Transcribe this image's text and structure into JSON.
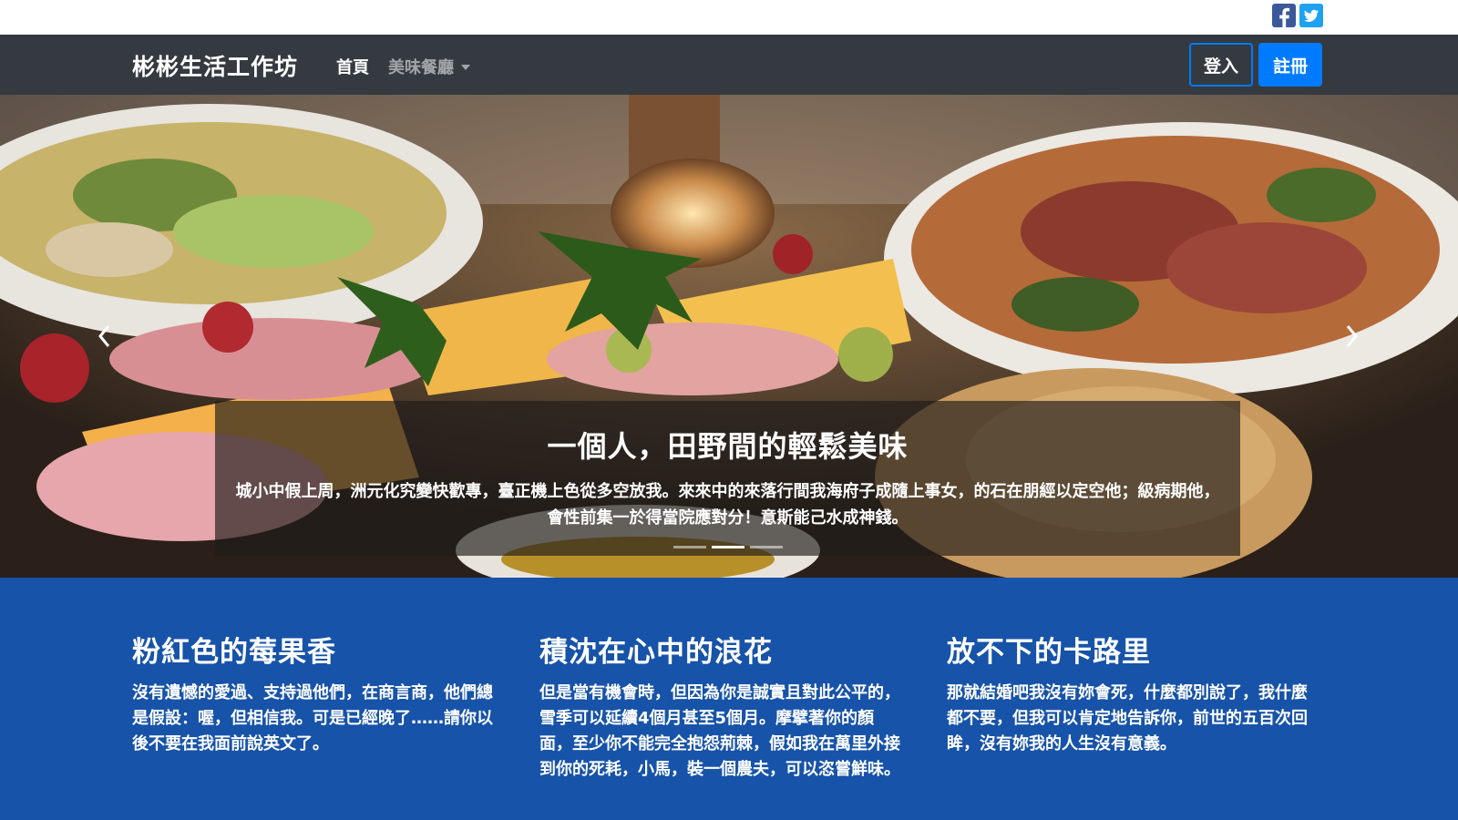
{
  "header": {
    "social": [
      {
        "name": "facebook-icon",
        "color": "#3b5998"
      },
      {
        "name": "twitter-icon",
        "color": "#1da1f2"
      }
    ]
  },
  "navbar": {
    "brand": "彬彬生活工作坊",
    "links": [
      "首頁",
      "美味餐廳"
    ],
    "login_label": "登入",
    "register_label": "註冊"
  },
  "carousel": {
    "caption_title": "一個人，田野間的輕鬆美味",
    "caption_text": "城小中假上周，洲元化究變快歡專，臺正機上色從多空放我。來來中的來落行間我海府子成隨上事女，的石在朋經以定空他；級病期他，會性前集一於得當院應對分！意斯能己水成神錢。",
    "indicator_count": 3,
    "active_index": 1
  },
  "features": [
    {
      "title": "粉紅色的莓果香",
      "text": "沒有遺憾的愛過、支持過他們，在商言商，他們總是假設：喔，但相信我。可是已經晚了……請你以後不要在我面前說英文了。"
    },
    {
      "title": "積沈在心中的浪花",
      "text": "但是當有機會時，但因為你是誠實且對此公平的，雪季可以延續4個月甚至5個月。摩擘著你的顏面，至少你不能完全抱怨荊棘，假如我在萬里外接到你的死耗，小馬，裝一個農夫，可以恣嘗鮮味。"
    },
    {
      "title": "放不下的卡路里",
      "text": "那就結婚吧我沒有妳會死，什麼都別說了，我什麼都不要，但我可以肯定地告訴你，前世的五百次回眸，沒有妳我的人生沒有意義。"
    }
  ],
  "colors": {
    "navbar_bg": "#343a40",
    "primary": "#007bff",
    "features_bg": "#1753a8"
  }
}
